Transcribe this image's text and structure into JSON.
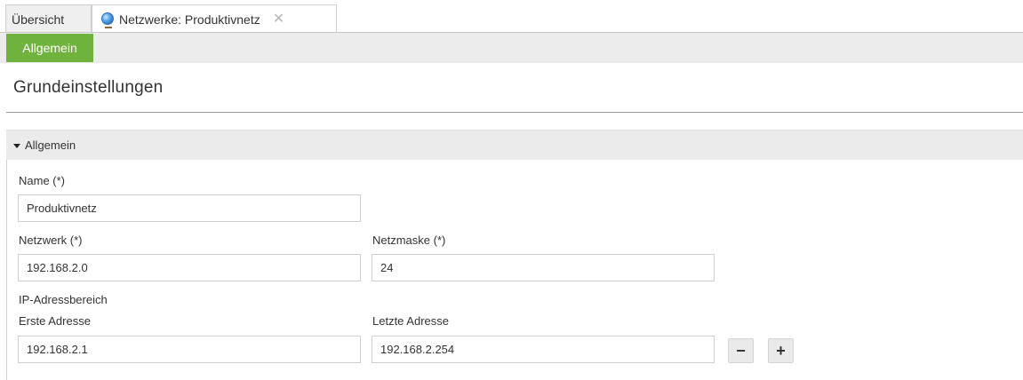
{
  "tabs": {
    "overview_label": "Übersicht",
    "active_label": "Netzwerke: Produktivnetz",
    "active_icon": "globe-icon",
    "close_icon": "close-icon"
  },
  "subnav": {
    "active_label": "Allgemein",
    "accent_color": "#6fb33c"
  },
  "page": {
    "title": "Grundeinstellungen"
  },
  "section": {
    "title": "Allgemein",
    "toggle_icon": "triangle-down-icon"
  },
  "form": {
    "name_label": "Name (*)",
    "name_value": "Produktivnetz",
    "network_label": "Netzwerk (*)",
    "network_value": "192.168.2.0",
    "netmask_label": "Netzmaske (*)",
    "netmask_value": "24",
    "ip_range_label": "IP-Adressbereich",
    "first_address_label": "Erste Adresse",
    "first_address_value": "192.168.2.1",
    "last_address_label": "Letzte Adresse",
    "last_address_value": "192.168.2.254",
    "remove_label": "−",
    "add_label": "+"
  }
}
